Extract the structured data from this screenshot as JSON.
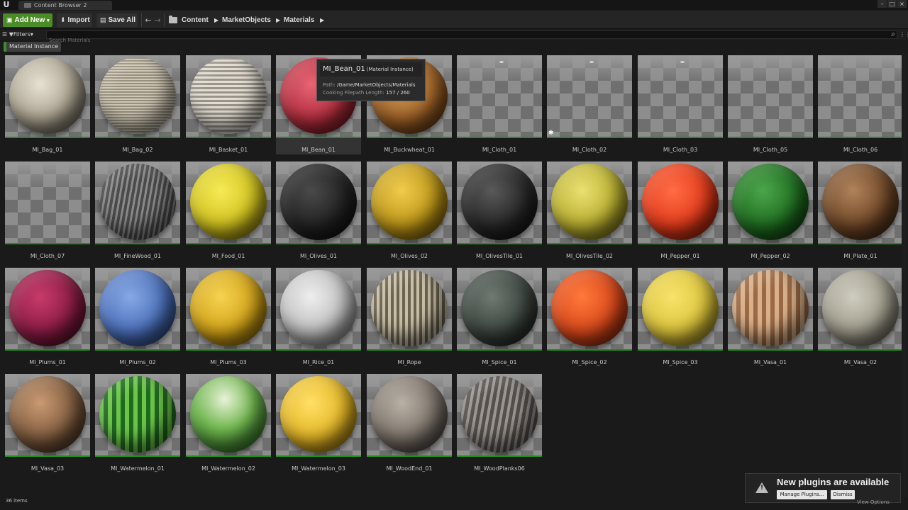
{
  "window": {
    "tab_title": "Content Browser 2",
    "controls": [
      "–",
      "□",
      "×"
    ]
  },
  "toolbar": {
    "add_new": "Add New",
    "import": "Import",
    "save_all": "Save All",
    "breadcrumb": [
      "Content",
      "MarketObjects",
      "Materials"
    ]
  },
  "filter_bar": {
    "filters_label": "Filters",
    "search_placeholder": "Search Materials"
  },
  "active_filter": "Material Instance",
  "assets": [
    {
      "name": "MI_Bag_01",
      "style": "bag1"
    },
    {
      "name": "MI_Bag_02",
      "style": "bag2"
    },
    {
      "name": "MI_Basket_01",
      "style": "basket"
    },
    {
      "name": "MI_Bean_01",
      "style": "bean"
    },
    {
      "name": "MI_Buckwheat_01",
      "style": "buckwheat"
    },
    {
      "name": "MI_Cloth_01",
      "style": "empty"
    },
    {
      "name": "MI_Cloth_02",
      "style": "empty"
    },
    {
      "name": "MI_Cloth_03",
      "style": "empty"
    },
    {
      "name": "MI_Cloth_05",
      "style": "empty"
    },
    {
      "name": "MI_Cloth_06",
      "style": "empty"
    },
    {
      "name": "MI_Cloth_07",
      "style": "empty"
    },
    {
      "name": "MI_FineWood_01",
      "style": "finewood"
    },
    {
      "name": "MI_Food_01",
      "style": "food"
    },
    {
      "name": "MI_Olives_01",
      "style": "olives1"
    },
    {
      "name": "MI_Olives_02",
      "style": "olives2"
    },
    {
      "name": "MI_OlivesTile_01",
      "style": "olivestile1"
    },
    {
      "name": "MI_OlivesTile_02",
      "style": "olivestile2"
    },
    {
      "name": "MI_Pepper_01",
      "style": "pepper1"
    },
    {
      "name": "MI_Pepper_02",
      "style": "pepper2"
    },
    {
      "name": "MI_Plate_01",
      "style": "plate"
    },
    {
      "name": "MI_Plums_01",
      "style": "plums1"
    },
    {
      "name": "MI_Plums_02",
      "style": "plums2"
    },
    {
      "name": "MI_Plums_03",
      "style": "plums3"
    },
    {
      "name": "MI_Rice_01",
      "style": "rice"
    },
    {
      "name": "MI_Rope",
      "style": "rope"
    },
    {
      "name": "MI_Spice_01",
      "style": "spice1"
    },
    {
      "name": "MI_Spice_02",
      "style": "spice2"
    },
    {
      "name": "MI_Spice_03",
      "style": "spice3"
    },
    {
      "name": "MI_Vasa_01",
      "style": "vasa1"
    },
    {
      "name": "MI_Vasa_02",
      "style": "vasa2"
    },
    {
      "name": "MI_Vasa_03",
      "style": "vasa3"
    },
    {
      "name": "MI_Watermelon_01",
      "style": "melon1"
    },
    {
      "name": "MI_Watermelon_02",
      "style": "melon2"
    },
    {
      "name": "MI_Watermelon_03",
      "style": "melon3"
    },
    {
      "name": "MI_WoodEnd_01",
      "style": "woodend"
    },
    {
      "name": "MI_WoodPlanks06",
      "style": "planks"
    }
  ],
  "tooltip": {
    "name": "MI_Bean_01",
    "type": "(Material Instance)",
    "path_label": "Path:",
    "path_value": "/Game/MarketObjects/Materials",
    "cook_label": "Cooking Filepath Length:",
    "cook_value": "157 / 260"
  },
  "status": {
    "item_count": "36 items",
    "view_options": "View Options"
  },
  "notification": {
    "title": "New plugins are available",
    "manage": "Manage Plugins...",
    "dismiss": "Dismiss"
  },
  "colors": {
    "accent_green": "#4b8c27",
    "type_bar": "#1f8f1a"
  }
}
